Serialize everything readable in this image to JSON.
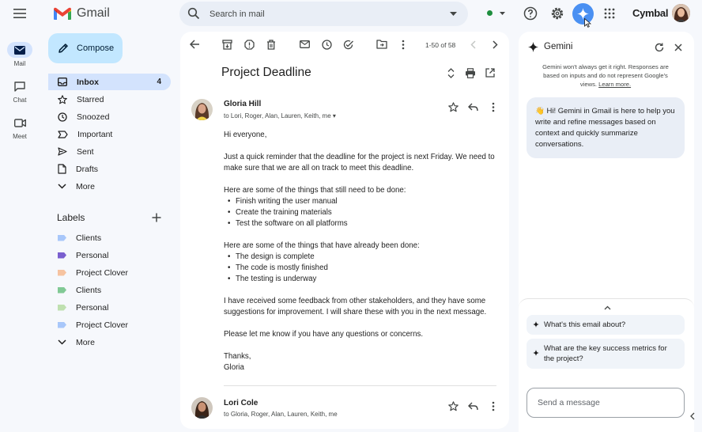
{
  "app": {
    "logo_text": "Gmail",
    "brand": "Cymbal"
  },
  "search": {
    "placeholder": "Search in mail"
  },
  "rail": [
    {
      "label": "Mail",
      "icon": "mail-icon"
    },
    {
      "label": "Chat",
      "icon": "chat-icon"
    },
    {
      "label": "Meet",
      "icon": "meet-icon"
    }
  ],
  "sidebar": {
    "compose_label": "Compose",
    "items": [
      {
        "label": "Inbox",
        "count": "4",
        "icon": "inbox-icon"
      },
      {
        "label": "Starred",
        "icon": "star-icon"
      },
      {
        "label": "Snoozed",
        "icon": "clock-icon"
      },
      {
        "label": "Important",
        "icon": "important-icon"
      },
      {
        "label": "Sent",
        "icon": "send-icon"
      },
      {
        "label": "Drafts",
        "icon": "draft-icon"
      },
      {
        "label": "More",
        "icon": "chevron-down-icon"
      }
    ],
    "labels_heading": "Labels",
    "labels": [
      {
        "label": "Clients",
        "color": "#a8c7fa"
      },
      {
        "label": "Personal",
        "color": "#7a5fcf"
      },
      {
        "label": "Project Clover",
        "color": "#f6c3a0"
      },
      {
        "label": "Clients",
        "color": "#81c995"
      },
      {
        "label": "Personal",
        "color": "#bfe0b0"
      },
      {
        "label": "Project Clover",
        "color": "#a8c7fa"
      },
      {
        "label": "More"
      }
    ]
  },
  "toolbar": {
    "pager": "1-50 of 58"
  },
  "email": {
    "subject": "Project Deadline",
    "messages": [
      {
        "sender": "Gloria Hill",
        "recipients": "to Lori, Roger, Alan, Lauren, Keith, me",
        "greeting": "Hi everyone,",
        "p1": "Just a quick reminder that the deadline for the project is next Friday. We need to make sure that we are all on track to meet this deadline.",
        "todo_intro": "Here are some of the things that still need to be done:",
        "todo": [
          "Finish writing the user manual",
          "Create the training materials",
          "Test the software on all platforms"
        ],
        "done_intro": "Here are some of the things that have already been done:",
        "done": [
          "The design is complete",
          "The code is mostly finished",
          "The testing is underway"
        ],
        "p2": "I have received some feedback from other stakeholders, and they have some suggestions for improvement. I will share these with you in the next message.",
        "p3": "Please let me know if you have any questions or concerns.",
        "signoff": "Thanks,",
        "signature": "Gloria"
      },
      {
        "sender": "Lori Cole",
        "recipients": "to Gloria, Roger, Alan, Lauren, Keith, me"
      }
    ]
  },
  "gemini": {
    "title": "Gemini",
    "disclaimer": "Gemini won't always get it right. Responses are based on inputs and do not represent Google's views.",
    "learn_more": "Learn more.",
    "welcome": "👋 Hi! Gemini in Gmail is here to help you write and refine messages based on context and quickly summarize conversations.",
    "suggestions": [
      "What's this email about?",
      "What are the key success metrics for the project?"
    ],
    "input_placeholder": "Send a message"
  },
  "colors": {
    "accent": "#0b57d0",
    "compose_bg": "#c2e7ff",
    "active_nav": "#d3e3fd",
    "gemini_btn": "#4a90f2"
  }
}
